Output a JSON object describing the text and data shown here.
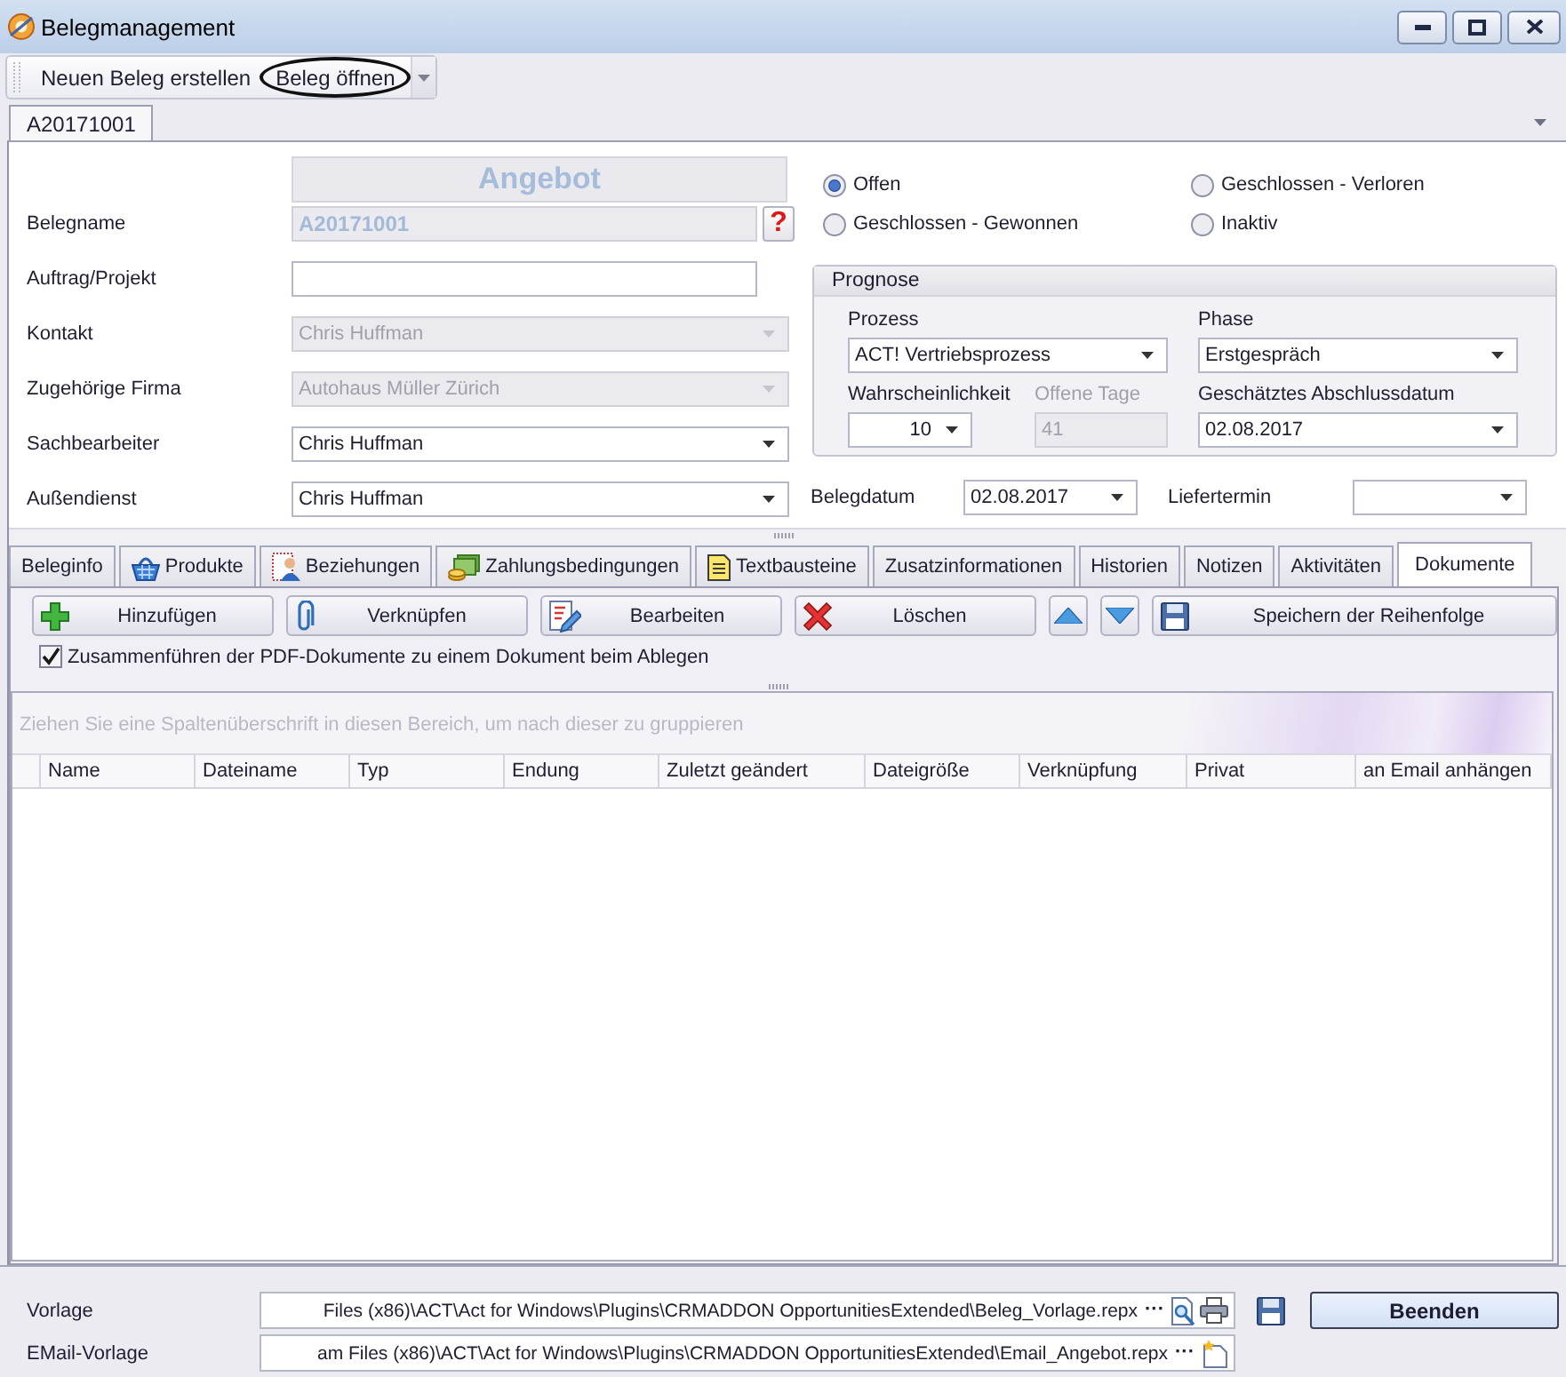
{
  "window": {
    "title": "Belegmanagement"
  },
  "toolbar": {
    "items": [
      {
        "label": "Neuen Beleg erstellen",
        "highlighted": false
      },
      {
        "label": "Beleg öffnen",
        "highlighted": true
      }
    ]
  },
  "document_tabs": [
    {
      "label": "A20171001",
      "selected": true
    }
  ],
  "form": {
    "header": "Angebot",
    "document_name": {
      "label": "Belegname",
      "value": "A20171001",
      "help": "?"
    },
    "fields": [
      {
        "label": "Auftrag/Projekt",
        "kind": "text",
        "disabled": false
      },
      {
        "label": "Kontakt",
        "kind": "combo",
        "value": "Chris Huffman",
        "disabled": true
      },
      {
        "label": "Zugehörige Firma",
        "kind": "combo",
        "value": "Autohaus Müller Zürich",
        "disabled": true
      },
      {
        "label": "Sachbearbeiter",
        "kind": "combo",
        "value": "Chris Huffman",
        "disabled": false
      },
      {
        "label": "Außendienst",
        "kind": "combo",
        "value": "Chris Huffman",
        "disabled": false
      }
    ]
  },
  "status_options": [
    {
      "label": "Offen",
      "selected": true
    },
    {
      "label": "Geschlossen - Verloren",
      "selected": false
    },
    {
      "label": "Geschlossen - Gewonnen",
      "selected": false
    },
    {
      "label": "Inaktiv",
      "selected": false
    }
  ],
  "prognose": {
    "title": "Prognose",
    "fields": [
      {
        "label": "Prozess",
        "kind": "combo",
        "value": "ACT! Vertriebsprozess",
        "disabled": false
      },
      {
        "label": "Phase",
        "kind": "combo",
        "value": "Erstgespräch",
        "disabled": false
      },
      {
        "label": "Wahrscheinlichkeit",
        "kind": "spin",
        "value": "10",
        "disabled": false
      },
      {
        "label": "Offene Tage",
        "kind": "text",
        "value": "41",
        "disabled": true
      },
      {
        "label": "Geschätztes Abschlussdatum",
        "kind": "combo",
        "value": "02.08.2017",
        "disabled": false
      }
    ]
  },
  "dates": [
    {
      "label": "Belegdatum",
      "value": "02.08.2017"
    },
    {
      "label": "Liefertermin"
    }
  ],
  "detail_tabs": [
    {
      "label": "Beleginfo",
      "selected": false
    },
    {
      "label": "Produkte",
      "selected": false
    },
    {
      "label": "Beziehungen",
      "selected": false
    },
    {
      "label": "Zahlungsbedingungen",
      "selected": false
    },
    {
      "label": "Textbausteine",
      "selected": false
    },
    {
      "label": "Zusatzinformationen",
      "selected": false
    },
    {
      "label": "Historien",
      "selected": false
    },
    {
      "label": "Notizen",
      "selected": false
    },
    {
      "label": "Aktivitäten",
      "selected": false
    },
    {
      "label": "Dokumente",
      "selected": true
    }
  ],
  "documents": {
    "buttons": [
      {
        "kind": "labeled",
        "label": "Hinzufügen"
      },
      {
        "kind": "labeled",
        "label": "Verknüpfen"
      },
      {
        "kind": "labeled",
        "label": "Bearbeiten"
      },
      {
        "kind": "labeled",
        "label": "Löschen"
      },
      {
        "kind": "move-up"
      },
      {
        "kind": "move-down"
      },
      {
        "kind": "labeled",
        "label": "Speichern der Reihenfolge"
      }
    ],
    "merge_pdf": {
      "label": "Zusammenführen der PDF-Dokumente zu einem Dokument beim Ablegen",
      "checked": true
    },
    "table": {
      "group_hint": "Ziehen Sie eine Spaltenüberschrift in diesen Bereich, um nach dieser zu gruppieren",
      "columns": [
        "Name",
        "Dateiname",
        "Typ",
        "Endung",
        "Zuletzt geändert",
        "Dateigröße",
        "Verknüpfung",
        "Privat",
        "an Email anhängen"
      ]
    }
  },
  "footer": {
    "templates": [
      {
        "label": "Vorlage",
        "value": "Files (x86)\\ACT\\Act for Windows\\Plugins\\CRMADDON OpportunitiesExtended\\Beleg_Vorlage.repx",
        "browse": "···"
      },
      {
        "label": "EMail-Vorlage",
        "value": "am Files (x86)\\ACT\\Act for Windows\\Plugins\\CRMADDON OpportunitiesExtended\\Email_Angebot.repx",
        "browse": "···"
      }
    ],
    "close_button": "Beenden"
  }
}
